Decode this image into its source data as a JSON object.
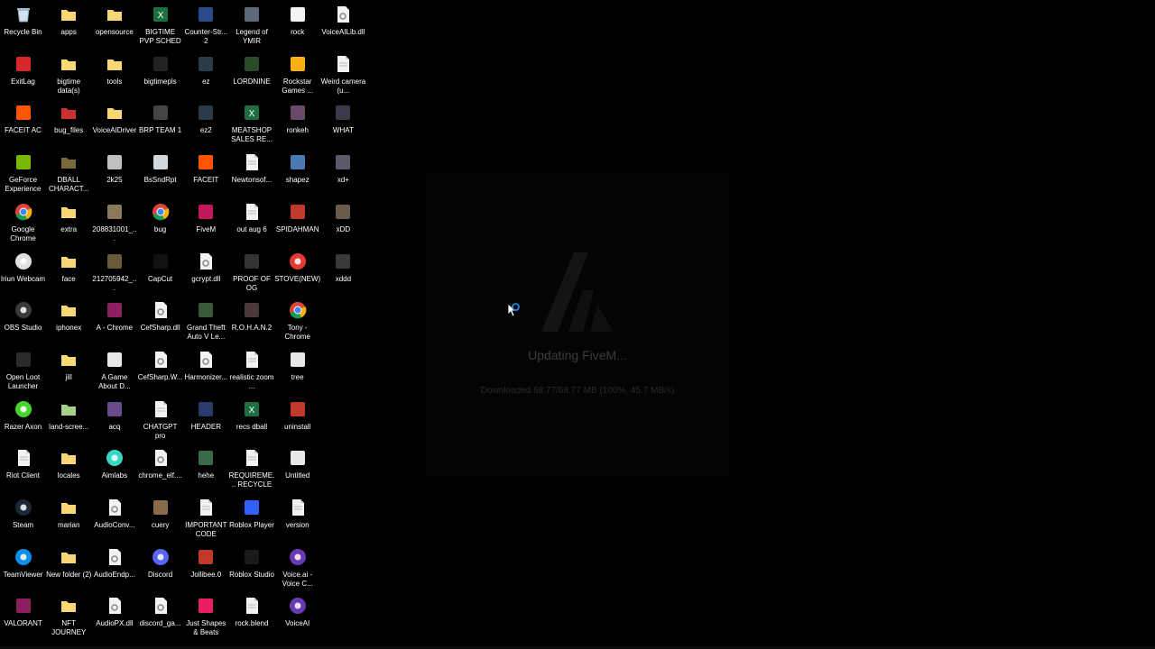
{
  "updater": {
    "title": "Updating FiveM...",
    "progress_text": "Downloaded 68.77/68.77 MB (100%, 45.7 MB/s)",
    "progress_percent": 100
  },
  "desktop_icons": [
    {
      "label": "Recycle Bin",
      "icon": "recycle-bin-icon",
      "color": "#9fb8d0"
    },
    {
      "label": "ExitLag",
      "icon": "exitlag-icon",
      "color": "#d62828"
    },
    {
      "label": "FACEIT AC",
      "icon": "faceit-ac-icon",
      "color": "#ff5500"
    },
    {
      "label": "GeForce Experience",
      "icon": "geforce-icon",
      "color": "#76b900"
    },
    {
      "label": "Google Chrome",
      "icon": "chrome-icon",
      "color": "#db4437"
    },
    {
      "label": "Iriun Webcam",
      "icon": "webcam-icon",
      "color": "#e0e0e0"
    },
    {
      "label": "OBS Studio",
      "icon": "obs-icon",
      "color": "#3a3a3a"
    },
    {
      "label": "Open Loot Launcher",
      "icon": "openloot-icon",
      "color": "#2b2b2b"
    },
    {
      "label": "Razer Axon",
      "icon": "razer-icon",
      "color": "#44d62c"
    },
    {
      "label": "Riot Client",
      "icon": "file-icon",
      "color": "#f2f2f2"
    },
    {
      "label": "Steam",
      "icon": "steam-icon",
      "color": "#1b2838"
    },
    {
      "label": "TeamViewer",
      "icon": "teamviewer-icon",
      "color": "#0e8ee9"
    },
    {
      "label": "VALORANT",
      "icon": "winrar-icon",
      "color": "#8b1f5f"
    },
    {
      "label": "apps",
      "icon": "folder-icon",
      "color": "#f8d775"
    },
    {
      "label": "bigtime data(s)",
      "icon": "folder-icon",
      "color": "#f8d775"
    },
    {
      "label": "bug_files",
      "icon": "folder-icon",
      "color": "#c83232"
    },
    {
      "label": "DBALL CHARACT...",
      "icon": "folder-icon",
      "color": "#7a6a3a"
    },
    {
      "label": "extra",
      "icon": "folder-icon",
      "color": "#f8d775"
    },
    {
      "label": "face",
      "icon": "folder-icon",
      "color": "#f8d775"
    },
    {
      "label": "iphonex",
      "icon": "folder-icon",
      "color": "#f8d775"
    },
    {
      "label": "jill",
      "icon": "folder-icon",
      "color": "#f8d775"
    },
    {
      "label": "land-scree...",
      "icon": "folder-icon",
      "color": "#a8d08d"
    },
    {
      "label": "locales",
      "icon": "folder-icon",
      "color": "#f8d775"
    },
    {
      "label": "marian",
      "icon": "folder-icon",
      "color": "#f8d775"
    },
    {
      "label": "New folder (2)",
      "icon": "folder-icon",
      "color": "#f8d775"
    },
    {
      "label": "NFT JOURNEY",
      "icon": "folder-icon",
      "color": "#f8d775"
    },
    {
      "label": "opensource",
      "icon": "folder-icon",
      "color": "#f8d775"
    },
    {
      "label": "tools",
      "icon": "folder-icon",
      "color": "#f8d775"
    },
    {
      "label": "VoiceAIDriver",
      "icon": "folder-icon",
      "color": "#f8d775"
    },
    {
      "label": "2k25",
      "icon": "image-icon",
      "color": "#c0c0c0"
    },
    {
      "label": "208831001_...",
      "icon": "image-icon",
      "color": "#8a7a5a"
    },
    {
      "label": "212705942_...",
      "icon": "image-icon",
      "color": "#6a5a3a"
    },
    {
      "label": "A - Chrome",
      "icon": "winrar-icon",
      "color": "#8b1f5f"
    },
    {
      "label": "A Game About D...",
      "icon": "game-icon",
      "color": "#e8e8e8"
    },
    {
      "label": "acq",
      "icon": "image-icon",
      "color": "#6a4a8a"
    },
    {
      "label": "Aimlabs",
      "icon": "aimlabs-icon",
      "color": "#3ad6c4"
    },
    {
      "label": "AudioConv...",
      "icon": "gear-file-icon",
      "color": "#f2f2f2"
    },
    {
      "label": "AudioEndp...",
      "icon": "gear-file-icon",
      "color": "#f2f2f2"
    },
    {
      "label": "AudioPX.dll",
      "icon": "gear-file-icon",
      "color": "#f2f2f2"
    },
    {
      "label": "BIGTIME PVP SCHED",
      "icon": "excel-icon",
      "color": "#1d6f42"
    },
    {
      "label": "bigtimepls",
      "icon": "image-icon",
      "color": "#222222"
    },
    {
      "label": "BRP TEAM 1",
      "icon": "image-icon",
      "color": "#444444"
    },
    {
      "label": "BsSndRpt",
      "icon": "gear-icon",
      "color": "#cfd8dc"
    },
    {
      "label": "bug",
      "icon": "chrome-icon",
      "color": "#db4437"
    },
    {
      "label": "CapCut",
      "icon": "capcut-icon",
      "color": "#111111"
    },
    {
      "label": "CefSharp.dll",
      "icon": "gear-file-icon",
      "color": "#f2f2f2"
    },
    {
      "label": "CefSharp.W...",
      "icon": "gear-file-icon",
      "color": "#f2f2f2"
    },
    {
      "label": "CHATGPT pro",
      "icon": "file-icon",
      "color": "#f2f2f2"
    },
    {
      "label": "chrome_elf....",
      "icon": "gear-file-icon",
      "color": "#f2f2f2"
    },
    {
      "label": "cuery",
      "icon": "image-icon",
      "color": "#8a6a4a"
    },
    {
      "label": "Discord",
      "icon": "discord-icon",
      "color": "#5865f2"
    },
    {
      "label": "discord_ga...",
      "icon": "gear-file-icon",
      "color": "#f2f2f2"
    },
    {
      "label": "Counter-Str... 2",
      "icon": "cs2-icon",
      "color": "#2a4a8a"
    },
    {
      "label": "ez",
      "icon": "image-icon",
      "color": "#2a3a4a"
    },
    {
      "label": "ez2",
      "icon": "image-icon",
      "color": "#2a3a4a"
    },
    {
      "label": "FACEIT",
      "icon": "faceit-icon",
      "color": "#ff5500"
    },
    {
      "label": "FiveM",
      "icon": "fivem-icon",
      "color": "#c2185b"
    },
    {
      "label": "gcrypt.dll",
      "icon": "gear-file-icon",
      "color": "#f2f2f2"
    },
    {
      "label": "Grand Theft Auto V Le...",
      "icon": "gta-icon",
      "color": "#3a5a3a"
    },
    {
      "label": "Harmonizer...",
      "icon": "gear-file-icon",
      "color": "#f2f2f2"
    },
    {
      "label": "HEADER",
      "icon": "image-icon",
      "color": "#2a3a6a"
    },
    {
      "label": "hehe",
      "icon": "image-icon",
      "color": "#3a6a4a"
    },
    {
      "label": "IMPORTANT CODE",
      "icon": "file-icon",
      "color": "#f2f2f2"
    },
    {
      "label": "Jollibee.0",
      "icon": "image-icon",
      "color": "#c0392b"
    },
    {
      "label": "Just Shapes & Beats",
      "icon": "jsb-icon",
      "color": "#e91e63"
    },
    {
      "label": "Legend of YMIR",
      "icon": "ymir-icon",
      "color": "#5a6a7a"
    },
    {
      "label": "LORDNINE",
      "icon": "lordnine-icon",
      "color": "#2a4a2a"
    },
    {
      "label": "MEATSHOP SALES RE...",
      "icon": "excel-icon",
      "color": "#1d6f42"
    },
    {
      "label": "Newtonsof...",
      "icon": "file-icon",
      "color": "#f2f2f2"
    },
    {
      "label": "out aug 6",
      "icon": "file-icon",
      "color": "#f2f2f2"
    },
    {
      "label": "PROOF OF OG",
      "icon": "image-icon",
      "color": "#333333"
    },
    {
      "label": "R.O.H.A.N.2",
      "icon": "image-icon",
      "color": "#4a3a3a"
    },
    {
      "label": "realistic zoom ...",
      "icon": "file-icon",
      "color": "#f2f2f2"
    },
    {
      "label": "recs dball",
      "icon": "excel-icon",
      "color": "#1d6f42"
    },
    {
      "label": "REQUIREME... RECYCLE",
      "icon": "file-icon",
      "color": "#f2f2f2"
    },
    {
      "label": "Roblox Player",
      "icon": "roblox-icon",
      "color": "#335fff"
    },
    {
      "label": "Roblox Studio",
      "icon": "roblox-studio-icon",
      "color": "#1a1a1a"
    },
    {
      "label": "rock.blend",
      "icon": "file-icon",
      "color": "#f2f2f2"
    },
    {
      "label": "rock",
      "icon": "cube-icon",
      "color": "#f2f2f2"
    },
    {
      "label": "Rockstar Games ...",
      "icon": "rockstar-icon",
      "color": "#fcaf17"
    },
    {
      "label": "ronkeh",
      "icon": "image-icon",
      "color": "#6a4a6a"
    },
    {
      "label": "shapez",
      "icon": "shapez-icon",
      "color": "#4a7ab0"
    },
    {
      "label": "SPIDAHMAN",
      "icon": "image-icon",
      "color": "#c0392b"
    },
    {
      "label": "STOVE(NEW)",
      "icon": "stove-icon",
      "color": "#e53935"
    },
    {
      "label": "Tony - Chrome",
      "icon": "chrome-icon",
      "color": "#db4437"
    },
    {
      "label": "tree",
      "icon": "image-icon",
      "color": "#e8e8e8"
    },
    {
      "label": "uninstall",
      "icon": "image-icon",
      "color": "#c0392b"
    },
    {
      "label": "Untitled",
      "icon": "image-icon",
      "color": "#e8e8e8"
    },
    {
      "label": "version",
      "icon": "file-icon",
      "color": "#f2f2f2"
    },
    {
      "label": "Voice.ai - Voice C...",
      "icon": "voiceai-icon",
      "color": "#6a3ab0"
    },
    {
      "label": "VoiceAI",
      "icon": "voiceai-icon",
      "color": "#6a3ab0"
    },
    {
      "label": "VoiceAILib.dll",
      "icon": "gear-file-icon",
      "color": "#f2f2f2"
    },
    {
      "label": "Weird camera (u...",
      "icon": "file-icon",
      "color": "#f2f2f2"
    },
    {
      "label": "WHAT",
      "icon": "image-icon",
      "color": "#3a3a4a"
    },
    {
      "label": "xd+",
      "icon": "image-icon",
      "color": "#5a5a6a"
    },
    {
      "label": "xDD",
      "icon": "image-icon",
      "color": "#6a5a4a"
    },
    {
      "label": "xddd",
      "icon": "image-icon",
      "color": "#3a3a3a"
    }
  ],
  "column_lengths": [
    13,
    13,
    13,
    13,
    13,
    13,
    13,
    6
  ]
}
